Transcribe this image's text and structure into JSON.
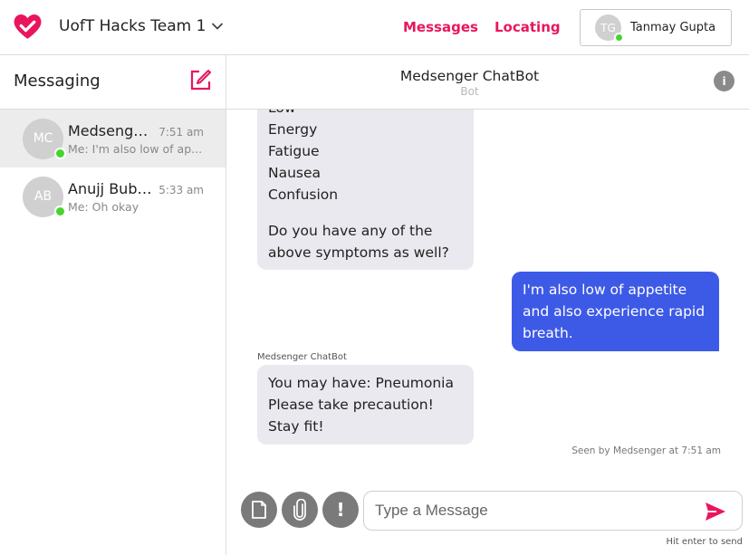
{
  "header": {
    "team_name": "UofT Hacks Team 1",
    "nav": {
      "messages": "Messages",
      "locating": "Locating"
    },
    "user": {
      "initials": "TG",
      "name": "Tanmay Gupta"
    },
    "accent_color": "#e8175d"
  },
  "sidebar": {
    "title": "Messaging",
    "conversations": [
      {
        "initials": "MC",
        "name": "Medsenger...",
        "time": "7:51 am",
        "preview": "Me: I'm also low of ap..."
      },
      {
        "initials": "AB",
        "name": "Anujj Bubna",
        "time": "5:33 am",
        "preview": "Me: Oh okay"
      }
    ]
  },
  "chat": {
    "title": "Medsenger ChatBot",
    "subtitle": "Bot",
    "info_label": "i",
    "messages": {
      "bot_1": {
        "lines": [
          "Low",
          "Energy",
          "Fatigue",
          "Nausea",
          "Confusion"
        ],
        "question": "Do you have any of the above symptoms as well?"
      },
      "me_1": {
        "text": "I'm also low of appetite and also experience rapid breath."
      },
      "bot_2": {
        "sender": "Medsenger ChatBot",
        "text": "You may have: Pneumonia Please take precaution! Stay fit!"
      }
    },
    "seen": "Seen by Medsenger at 7:51 am",
    "bubble_colors": {
      "bot": "#e9e9ef",
      "me": "#3d5ae6"
    }
  },
  "composer": {
    "placeholder": "Type a Message",
    "alert_label": "!",
    "hint": "Hit enter to send",
    "icons": [
      "document-icon",
      "paperclip-icon",
      "alert-icon",
      "send-icon"
    ]
  }
}
